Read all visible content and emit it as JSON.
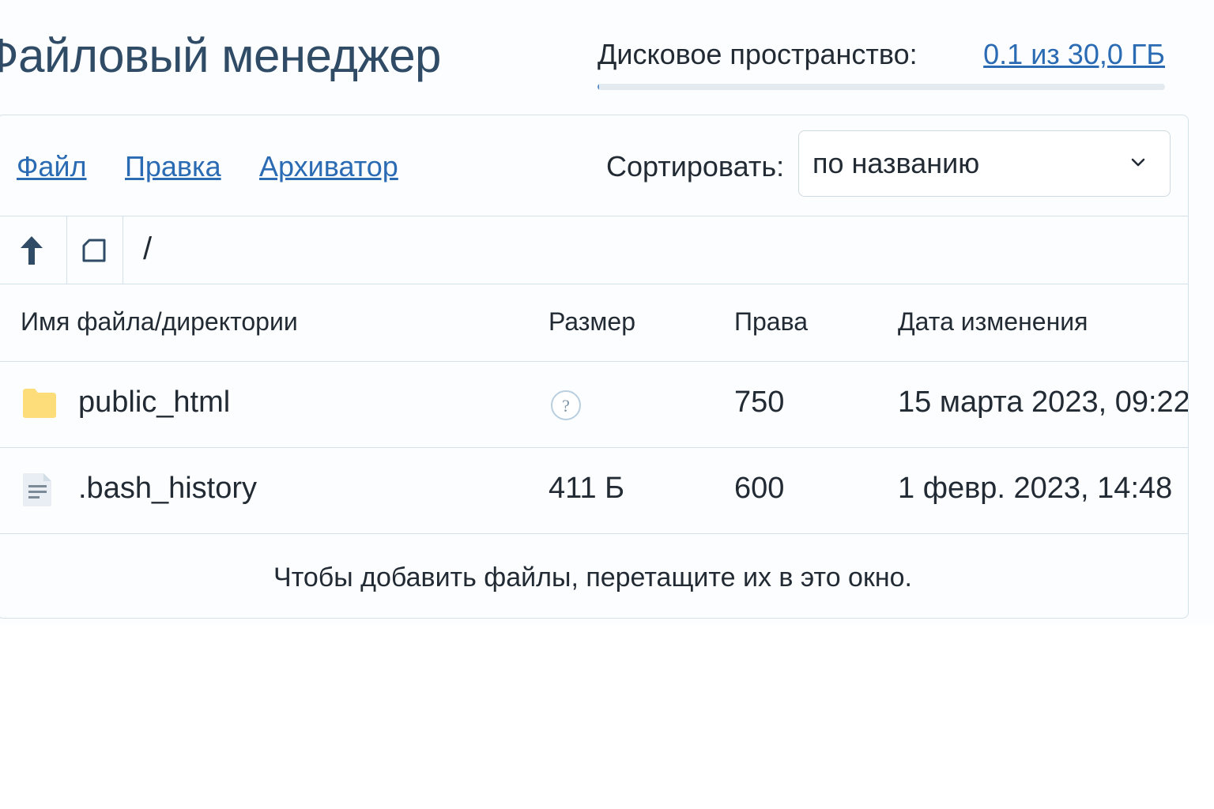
{
  "page": {
    "title": "Файловый менеджер"
  },
  "disk": {
    "label": "Дисковое пространство:",
    "value": "0.1 из 30,0 ГБ",
    "used_fraction": 0.0033
  },
  "menu": {
    "file": "Файл",
    "edit": "Правка",
    "archiver": "Архиватор"
  },
  "sort": {
    "label": "Сортировать:",
    "selected": "по названию"
  },
  "toolbar": {
    "path": "/",
    "icons": [
      "arrow-up-icon",
      "new-file-icon"
    ]
  },
  "table": {
    "columns": {
      "name": "Имя файла/директории",
      "size": "Размер",
      "perms": "Права",
      "modified": "Дата изменения"
    },
    "rows": [
      {
        "icon": "folder-icon",
        "name": "public_html",
        "size_icon": "question-icon",
        "perms": "750",
        "modified": "15 марта 2023, 09:22"
      },
      {
        "icon": "text-file-icon",
        "name": ".bash_history",
        "size": "411 Б",
        "perms": "600",
        "modified": "1 февр. 2023, 14:48"
      }
    ]
  },
  "footer": {
    "hint": "Чтобы добавить файлы, перетащите их в это окно."
  },
  "colors": {
    "title": "#2f4b66",
    "link": "#2a6bb3",
    "border": "#d3e1ea",
    "folder": "#fddc7a"
  }
}
